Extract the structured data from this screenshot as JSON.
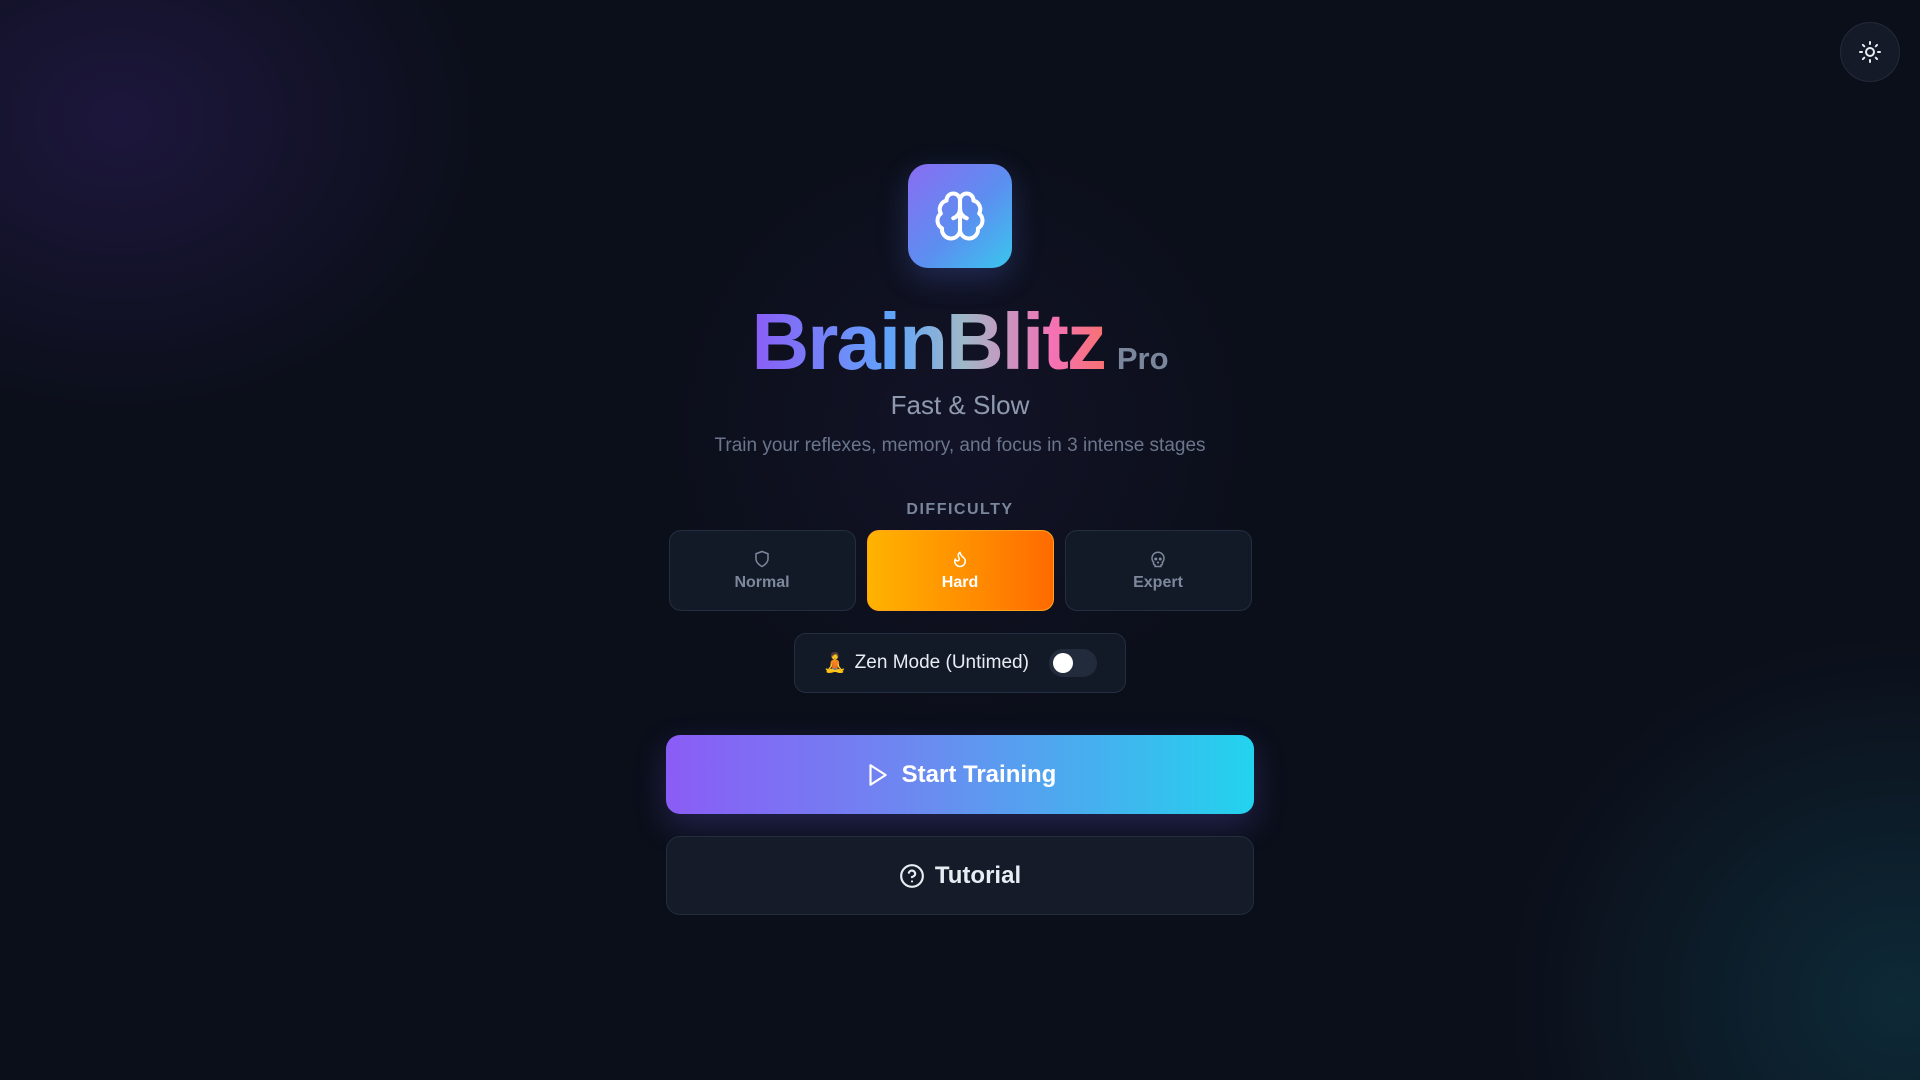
{
  "header": {
    "theme_toggle_icon": "sun-icon"
  },
  "hero": {
    "logo_icon": "brain-icon",
    "title": "BrainBlitz",
    "title_badge": "Pro",
    "subtitle": "Fast & Slow",
    "tagline": "Train your reflexes, memory, and focus in 3 intense stages"
  },
  "difficulty": {
    "label": "DIFFICULTY",
    "options": [
      {
        "label": "Normal",
        "icon": "shield-icon",
        "selected": false
      },
      {
        "label": "Hard",
        "icon": "flame-icon",
        "selected": true
      },
      {
        "label": "Expert",
        "icon": "skull-icon",
        "selected": false
      }
    ]
  },
  "zen_mode": {
    "emoji": "🧘",
    "label": "Zen Mode (Untimed)",
    "enabled": false
  },
  "actions": {
    "start_label": "Start Training",
    "start_icon": "play-icon",
    "tutorial_label": "Tutorial",
    "tutorial_icon": "help-circle-icon"
  },
  "colors": {
    "background": "#0b0f1a",
    "accent_purple": "#8b5cf6",
    "accent_cyan": "#22d3ee",
    "hard_orange": "#ff8a00"
  }
}
